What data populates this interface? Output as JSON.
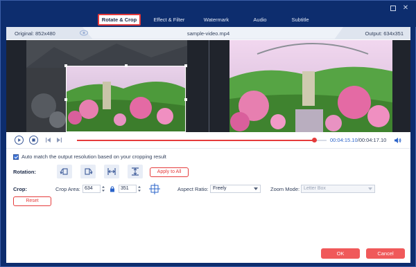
{
  "tabs": [
    {
      "label": "Rotate & Crop",
      "active": true
    },
    {
      "label": "Effect & Filter",
      "active": false
    },
    {
      "label": "Watermark",
      "active": false
    },
    {
      "label": "Audio",
      "active": false
    },
    {
      "label": "Subtitle",
      "active": false
    }
  ],
  "window_controls": {
    "maximize_icon": "maximize-icon",
    "close_icon": "close-icon",
    "close_glyph": "✕"
  },
  "infobar": {
    "original": "Original: 852x480",
    "filename": "sample-video.mp4",
    "output": "Output: 634x351"
  },
  "player": {
    "current_time": "00:04:15.10",
    "total_time": "/00:04:17.10",
    "progress": 0.95
  },
  "auto_match": {
    "checked": true,
    "label": "Auto match the output resolution based on your cropping result"
  },
  "rotation": {
    "label": "Rotation:",
    "apply_all": "Apply to All"
  },
  "crop": {
    "label": "Crop:",
    "area_label": "Crop Area:",
    "width": "634",
    "height": "351",
    "aspect_label": "Aspect Ratio:",
    "aspect_value": "Freely",
    "zoom_label": "Zoom Mode:",
    "zoom_value": "Letter Box",
    "reset": "Reset"
  },
  "footer": {
    "ok": "OK",
    "cancel": "Cancel"
  },
  "colors": {
    "accent": "#e53b3b",
    "frame": "#0d2d6e",
    "link": "#2a63c9"
  }
}
